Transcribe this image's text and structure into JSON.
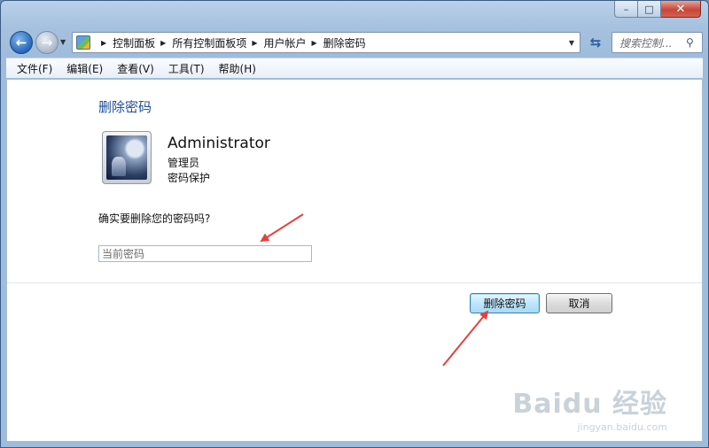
{
  "window": {
    "caption_buttons": {
      "minimize": "–",
      "maximize": "□",
      "close": "✕"
    }
  },
  "nav": {
    "back_icon": "arrow-left-icon",
    "forward_icon": "arrow-right-icon"
  },
  "addressbar": {
    "breadcrumbs": [
      "控制面板",
      "所有控制面板项",
      "用户帐户",
      "删除密码"
    ]
  },
  "search": {
    "placeholder": "搜索控制..."
  },
  "menu": {
    "items": [
      "文件(F)",
      "编辑(E)",
      "查看(V)",
      "工具(T)",
      "帮助(H)"
    ]
  },
  "page": {
    "title": "删除密码",
    "account": {
      "name": "Administrator",
      "role": "管理员",
      "protection": "密码保护"
    },
    "question": "确实要删除您的密码吗?",
    "password_input": {
      "placeholder": "当前密码",
      "value": ""
    },
    "buttons": {
      "delete": "删除密码",
      "cancel": "取消"
    }
  },
  "annotation": {
    "arrow_color": "#e8413b"
  },
  "watermark": {
    "brand": "Baidu 经验",
    "url": "jingyan.baidu.com"
  }
}
